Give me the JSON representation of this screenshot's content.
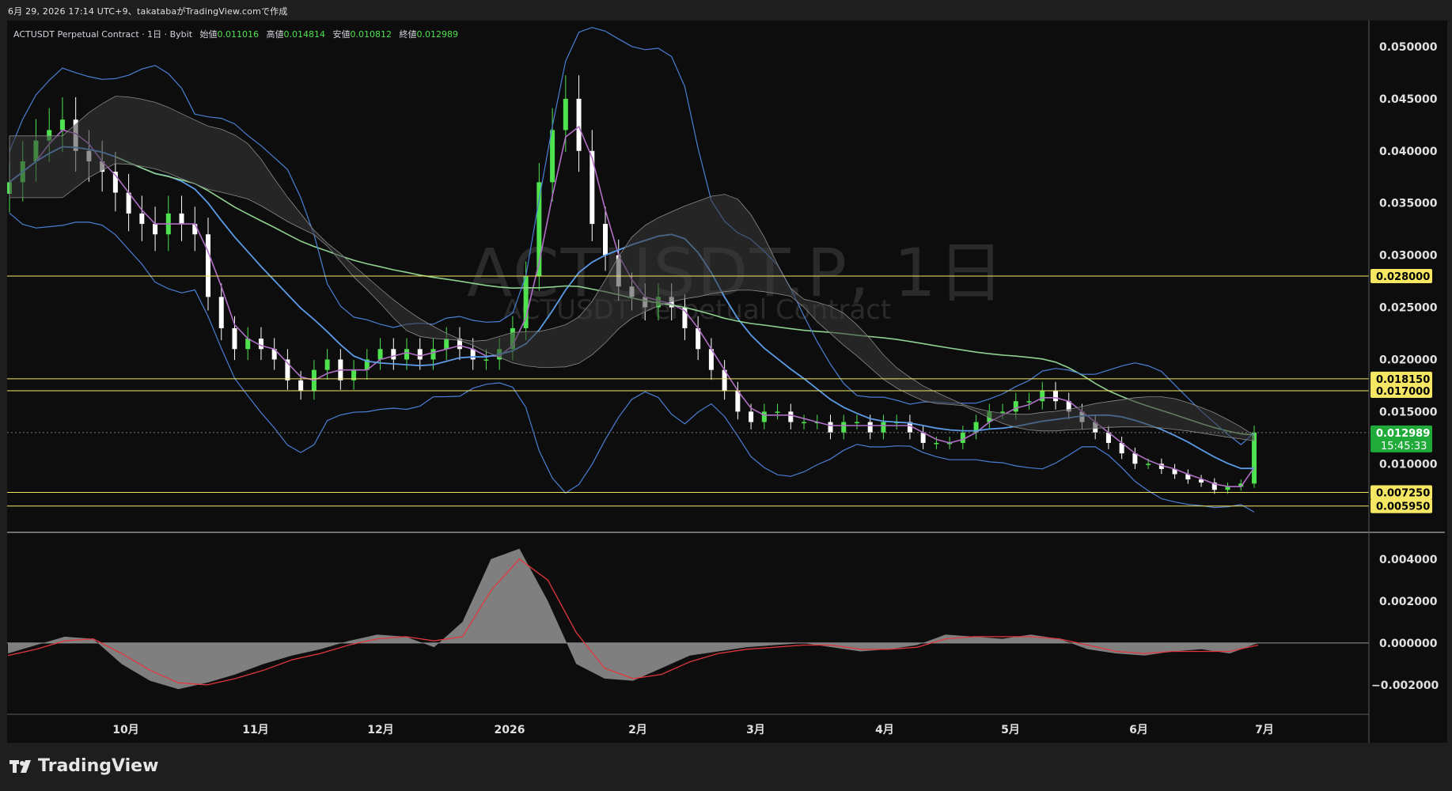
{
  "header": {
    "meta": "6月 29, 2026 17:14 UTC+9、takatabaがTradingView.comで作成"
  },
  "legend": {
    "symbol": "ACTUSDT Perpetual Contract · 1日 · Bybit",
    "open_label": "始値",
    "open": "0.011016",
    "high_label": "高値",
    "high": "0.014814",
    "low_label": "安値",
    "low": "0.010812",
    "close_label": "終値",
    "close": "0.012989"
  },
  "watermark": {
    "main": "ACTUSDT.P, 1日",
    "sub": "ACTUSDT Perpetual Contract"
  },
  "brand": {
    "name": "TradingView"
  },
  "colors": {
    "up": "#4fe24f",
    "down": "#ffffff",
    "bollinger": "#4a7fd4",
    "ma_fast": "#b06fc7",
    "ma_mid": "#5b9be6",
    "ma_slow": "#8fd18f",
    "levels": "#f5e663",
    "cloud": "#3a3a3a",
    "macd_hist": "#8c8c8c",
    "macd_signal": "#e0383e"
  },
  "chart_data": [
    {
      "type": "candlestick",
      "title": "",
      "x_ticks": [
        "10月",
        "11月",
        "12月",
        "2026",
        "2月",
        "3月",
        "4月",
        "5月",
        "6月",
        "7月"
      ],
      "y_ticks": [
        "0.050000",
        "0.045000",
        "0.040000",
        "0.035000",
        "0.030000",
        "0.025000",
        "0.020000",
        "0.015000",
        "0.010000"
      ],
      "ylim": [
        0.0035,
        0.0525
      ],
      "levels": [
        {
          "value": 0.028,
          "label": "0.028000"
        },
        {
          "value": 0.01815,
          "label": "0.018150"
        },
        {
          "value": 0.017,
          "label": "0.017000"
        },
        {
          "value": 0.00725,
          "label": "0.007250"
        },
        {
          "value": 0.00595,
          "label": "0.005950"
        }
      ],
      "last_price": {
        "value": 0.012989,
        "label": "0.012989",
        "countdown": "15:45:33"
      },
      "series_close": [
        0.037,
        0.039,
        0.041,
        0.042,
        0.043,
        0.04,
        0.039,
        0.038,
        0.036,
        0.034,
        0.033,
        0.032,
        0.034,
        0.033,
        0.032,
        0.026,
        0.023,
        0.021,
        0.022,
        0.021,
        0.02,
        0.018,
        0.017,
        0.019,
        0.02,
        0.018,
        0.019,
        0.02,
        0.021,
        0.02,
        0.021,
        0.02,
        0.021,
        0.022,
        0.021,
        0.02,
        0.02,
        0.021,
        0.023,
        0.028,
        0.037,
        0.042,
        0.045,
        0.04,
        0.033,
        0.03,
        0.027,
        0.026,
        0.025,
        0.026,
        0.025,
        0.023,
        0.021,
        0.019,
        0.017,
        0.015,
        0.014,
        0.015,
        0.015,
        0.014,
        0.014,
        0.014,
        0.013,
        0.014,
        0.014,
        0.013,
        0.014,
        0.014,
        0.013,
        0.012,
        0.012,
        0.012,
        0.013,
        0.014,
        0.015,
        0.015,
        0.016,
        0.016,
        0.017,
        0.016,
        0.015,
        0.014,
        0.013,
        0.012,
        0.011,
        0.01,
        0.01,
        0.0095,
        0.009,
        0.0085,
        0.0082,
        0.0075,
        0.0078,
        0.0081,
        0.013
      ]
    },
    {
      "type": "area",
      "title": "",
      "y_ticks": [
        "0.004000",
        "0.002000",
        "0.000000",
        "−0.002000"
      ],
      "ylim": [
        -0.0034,
        0.0052
      ],
      "series": [
        {
          "values": [
            -0.0005,
            -0.0001,
            0.0003,
            0.0002,
            -0.001,
            -0.0018,
            -0.0022,
            -0.0019,
            -0.0015,
            -0.001,
            -0.0006,
            -0.0003,
            0.0001,
            0.0004,
            0.0003,
            -0.0002,
            0.001,
            0.004,
            0.0045,
            0.002,
            -0.001,
            -0.0017,
            -0.0018,
            -0.0012,
            -0.0006,
            -0.0004,
            -0.0002,
            -0.0001,
            0.0,
            -0.0002,
            -0.0004,
            -0.0003,
            -0.0001,
            0.0004,
            0.0003,
            0.0002,
            0.0004,
            0.0002,
            -0.0003,
            -0.0005,
            -0.0006,
            -0.0004,
            -0.0003,
            -0.0005,
            0.0
          ]
        },
        {
          "values": [
            -0.0006,
            -0.0003,
            0.0001,
            0.0002,
            -0.0005,
            -0.0013,
            -0.0019,
            -0.002,
            -0.0017,
            -0.0013,
            -0.0008,
            -0.0005,
            -0.0001,
            0.0002,
            0.0003,
            0.0001,
            0.0003,
            0.0025,
            0.004,
            0.003,
            0.0005,
            -0.0012,
            -0.0017,
            -0.0015,
            -0.0009,
            -0.0005,
            -0.0003,
            -0.0002,
            -0.0001,
            -0.0001,
            -0.0003,
            -0.0003,
            -0.0002,
            0.0002,
            0.0003,
            0.0003,
            0.0003,
            0.0002,
            -0.0001,
            -0.0004,
            -0.0005,
            -0.0004,
            -0.0004,
            -0.0004,
            -0.0001
          ]
        }
      ]
    }
  ]
}
